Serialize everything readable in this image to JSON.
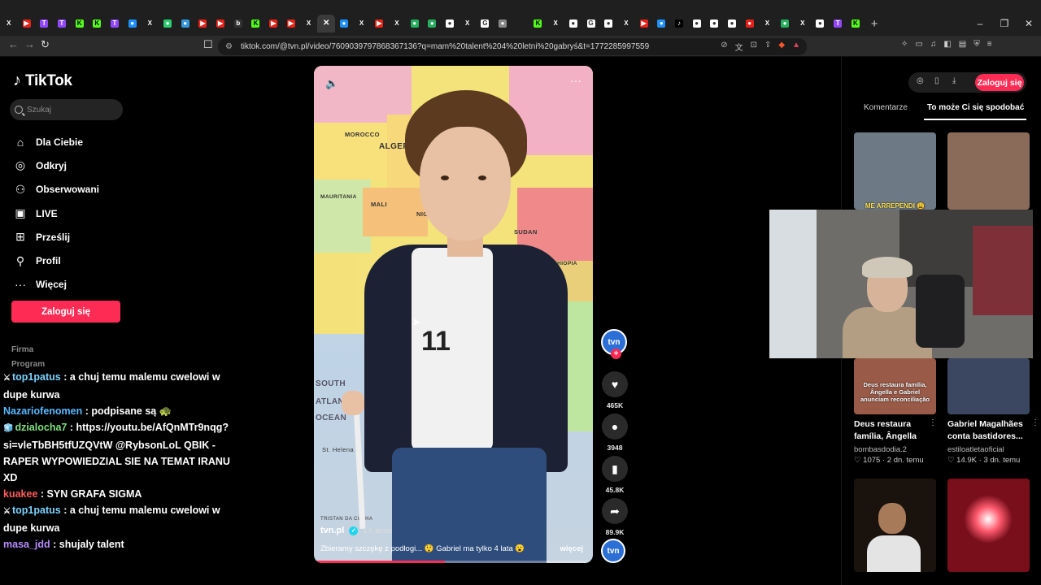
{
  "browser": {
    "tabs": [
      {
        "icon": "x-icon",
        "glyph": "X",
        "color": "#000000"
      },
      {
        "icon": "youtube-icon",
        "glyph": "▶",
        "color": "#e62117"
      },
      {
        "icon": "twitch-icon",
        "glyph": "T",
        "color": "#9146ff"
      },
      {
        "icon": "twitch-icon",
        "glyph": "T",
        "color": "#9146ff"
      },
      {
        "icon": "kick-icon",
        "glyph": "K",
        "color": "#53fc18"
      },
      {
        "icon": "kick-icon",
        "glyph": "K",
        "color": "#53fc18"
      },
      {
        "icon": "twitch-icon",
        "glyph": "T",
        "color": "#9146ff"
      },
      {
        "icon": "generic-icon",
        "glyph": "●",
        "color": "#1e90ff"
      },
      {
        "icon": "x-icon",
        "glyph": "X",
        "color": "#000000"
      },
      {
        "icon": "generic-icon",
        "glyph": "●",
        "color": "#2ecc71"
      },
      {
        "icon": "generic-icon",
        "glyph": "●",
        "color": "#3498db"
      },
      {
        "icon": "youtube-icon",
        "glyph": "▶",
        "color": "#e62117"
      },
      {
        "icon": "youtube-icon",
        "glyph": "▶",
        "color": "#e62117"
      },
      {
        "icon": "generic-icon",
        "glyph": "b",
        "color": "#333333"
      },
      {
        "icon": "kick-icon",
        "glyph": "K",
        "color": "#53fc18"
      },
      {
        "icon": "youtube-icon",
        "glyph": "▶",
        "color": "#e62117"
      },
      {
        "icon": "youtube-icon",
        "glyph": "▶",
        "color": "#e62117"
      },
      {
        "icon": "x-icon",
        "glyph": "X",
        "color": "#000000"
      },
      {
        "icon": "close-icon",
        "glyph": "✕",
        "color": "#3a3a3a"
      },
      {
        "icon": "generic-icon",
        "glyph": "●",
        "color": "#1e90ff"
      },
      {
        "icon": "x-icon",
        "glyph": "X",
        "color": "#000000"
      },
      {
        "icon": "youtube-icon",
        "glyph": "▶",
        "color": "#e62117"
      },
      {
        "icon": "x-icon",
        "glyph": "X",
        "color": "#000000"
      },
      {
        "icon": "generic-icon",
        "glyph": "●",
        "color": "#27ae60"
      },
      {
        "icon": "generic-icon",
        "glyph": "●",
        "color": "#27ae60"
      },
      {
        "icon": "generic-icon",
        "glyph": "●",
        "color": "#ffffff"
      },
      {
        "icon": "x-icon",
        "glyph": "X",
        "color": "#000000"
      },
      {
        "icon": "google-icon",
        "glyph": "G",
        "color": "#ffffff"
      },
      {
        "icon": "generic-icon",
        "glyph": "●",
        "color": "#888888"
      },
      {
        "icon": "generic-icon",
        "glyph": "",
        "color": "#1f1f1f"
      },
      {
        "icon": "kick-icon",
        "glyph": "K",
        "color": "#53fc18"
      },
      {
        "icon": "x-icon",
        "glyph": "X",
        "color": "#000000"
      },
      {
        "icon": "generic-icon",
        "glyph": "●",
        "color": "#ffffff"
      },
      {
        "icon": "google-icon",
        "glyph": "G",
        "color": "#ffffff"
      },
      {
        "icon": "generic-icon",
        "glyph": "●",
        "color": "#ffffff"
      },
      {
        "icon": "x-icon",
        "glyph": "X",
        "color": "#000000"
      },
      {
        "icon": "youtube-icon",
        "glyph": "▶",
        "color": "#e62117"
      },
      {
        "icon": "generic-icon",
        "glyph": "●",
        "color": "#1e90ff"
      },
      {
        "icon": "tiktok-icon",
        "glyph": "♪",
        "color": "#000000"
      },
      {
        "icon": "generic-icon",
        "glyph": "●",
        "color": "#ffffff"
      },
      {
        "icon": "generic-icon",
        "glyph": "●",
        "color": "#ffffff"
      },
      {
        "icon": "generic-icon",
        "glyph": "●",
        "color": "#ffffff"
      },
      {
        "icon": "generic-icon",
        "glyph": "●",
        "color": "#e62117"
      },
      {
        "icon": "x-icon",
        "glyph": "X",
        "color": "#000000"
      },
      {
        "icon": "generic-icon",
        "glyph": "●",
        "color": "#27ae60"
      },
      {
        "icon": "x-icon",
        "glyph": "X",
        "color": "#000000"
      },
      {
        "icon": "generic-icon",
        "glyph": "●",
        "color": "#ffffff"
      },
      {
        "icon": "twitch-icon",
        "glyph": "T",
        "color": "#9146ff"
      },
      {
        "icon": "kick-icon",
        "glyph": "K",
        "color": "#53fc18"
      }
    ],
    "new_tab": "+",
    "window_controls": [
      "–",
      "❐",
      "✕"
    ],
    "back": "←",
    "forward": "→",
    "reload": "↻",
    "bookmark": "☐",
    "url": "tiktok.com/@tvn.pl/video/7609039797868367136?q=mam%20talent%204%20letni%20gabryś&t=1772285997559"
  },
  "tiktok": {
    "logo": "TikTok",
    "search_placeholder": "Szukaj",
    "nav": [
      {
        "icon": "home-icon",
        "glyph": "⌂",
        "label": "Dla Ciebie"
      },
      {
        "icon": "compass-icon",
        "glyph": "◎",
        "label": "Odkryj"
      },
      {
        "icon": "following-icon",
        "glyph": "⚇",
        "label": "Obserwowani"
      },
      {
        "icon": "live-icon",
        "glyph": "▣",
        "label": "LIVE"
      },
      {
        "icon": "upload-icon",
        "glyph": "⊞",
        "label": "Prześlij"
      },
      {
        "icon": "profile-icon",
        "glyph": "⚲",
        "label": "Profil"
      },
      {
        "icon": "more-icon",
        "glyph": "···",
        "label": "Więcej"
      }
    ],
    "login": "Zaloguj się",
    "footer": [
      "Firma",
      "Program"
    ]
  },
  "chat": [
    {
      "badge": "⚔",
      "user": "top1patus",
      "color": "#7bd3ff",
      "text": ": a chuj temu malemu cwelowi w dupe kurwa"
    },
    {
      "badge": "",
      "user": "Nazariofenomen",
      "color": "#5ab9ff",
      "text": ": podpisane są 🐢"
    },
    {
      "badge": "🧊",
      "user": "dzialocha7",
      "color": "#7de07d",
      "text": ": https://youtu.be/AfQnMTr9nqg?si=vleTbBH5tfUZQVtW @RybsonLoL QBIK - RAPER WYPOWIEDZIAL SIE NA TEMAT IRANU XD"
    },
    {
      "badge": "",
      "user": "kuakee",
      "color": "#ff5c5c",
      "text": ": SYN GRAFA SIGMA"
    },
    {
      "badge": "⚔",
      "user": "top1patus",
      "color": "#7bd3ff",
      "text": ": a chuj temu malemu cwelowi w dupe kurwa"
    },
    {
      "badge": "",
      "user": "masa_jdd",
      "color": "#b58cff",
      "text": ": shujaly talent"
    }
  ],
  "video": {
    "author": "tvn.pl",
    "time": "1 t. temu",
    "caption": "Zbieramy szczękę z podłogi... 😲 Gabriel ma tylko 4 lata 😮",
    "more": "więcej",
    "progress": 0.47,
    "map_labels": [
      "MOROCCO",
      "ALGERIA",
      "MALI",
      "MAURITANIA",
      "NIGER",
      "SUDAN",
      "ETHIOPIA",
      "SOUTH",
      "ATLANTIC",
      "OCEAN",
      "St. Helena",
      "TRISTAN DA CUNHA"
    ],
    "shirt_number": "11"
  },
  "actions": {
    "avatar": "tvn",
    "plus": "+",
    "like": {
      "icon": "heart-icon",
      "glyph": "♥",
      "count": "465K"
    },
    "comment": {
      "icon": "comment-icon",
      "glyph": "💬",
      "count": "3948"
    },
    "save": {
      "icon": "bookmark-icon",
      "glyph": "🔖",
      "count": "45.8K"
    },
    "share": {
      "icon": "share-icon",
      "glyph": "➦",
      "count": "89.9K"
    }
  },
  "right_panel": {
    "login": "Zaloguj się",
    "tab_comments": "Komentarze",
    "tab_suggested": "To może Ci się spodobać",
    "thumbs_top": [
      {
        "overlay": "ME ARREPENDI 😩",
        "color": "#6d7a86"
      },
      {
        "overlay": "",
        "color": "#8a6a58"
      }
    ],
    "cards": [
      {
        "overlay": "Deus restaura família, Ângella e Gabriel anunciam reconciliação",
        "title": "Deus restaura família, Ângella e...",
        "author": "bombasdodia.2",
        "likes": "1075",
        "time": "2 dn. temu",
        "color": "#9a5a48"
      },
      {
        "overlay": "",
        "title": "Gabriel Magalhães conta bastidores...",
        "author": "estiloatletaoficial",
        "likes": "14.9K",
        "time": "3 dn. temu",
        "color": "#3b4660"
      }
    ],
    "thumbs_bottom": [
      {
        "overlay": "",
        "color": "#1a120c"
      },
      {
        "overlay": "",
        "color": "#7a0f1c"
      }
    ]
  }
}
